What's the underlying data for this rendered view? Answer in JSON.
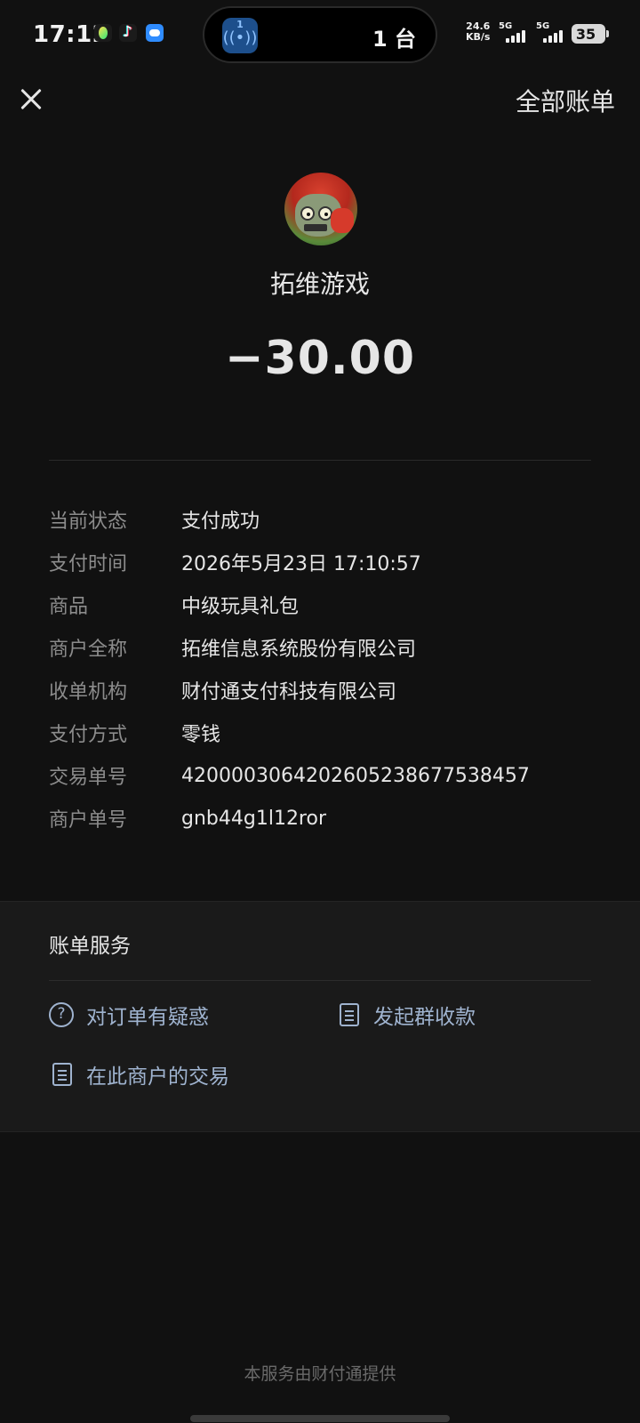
{
  "status_bar": {
    "time": "17:12",
    "island_count": "1",
    "island_text": "1 台",
    "net_speed_value": "24.6",
    "net_speed_unit": "KB/s",
    "sim1_label": "5G",
    "sim2_label": "5G",
    "battery": "35"
  },
  "header": {
    "all_bills_label": "全部账单"
  },
  "merchant": {
    "name": "拓维游戏",
    "amount": "−30.00"
  },
  "details": [
    {
      "key": "当前状态",
      "value": "支付成功"
    },
    {
      "key": "支付时间",
      "value": "2026年5月23日 17:10:57"
    },
    {
      "key": "商品",
      "value": "中级玩具礼包"
    },
    {
      "key": "商户全称",
      "value": "拓维信息系统股份有限公司"
    },
    {
      "key": "收单机构",
      "value": "财付通支付科技有限公司"
    },
    {
      "key": "支付方式",
      "value": "零钱"
    },
    {
      "key": "交易单号",
      "value": "4200003064202605238677538457"
    },
    {
      "key": "商户单号",
      "value": "gnb44g1l12ror"
    }
  ],
  "services": {
    "title": "账单服务",
    "items": [
      {
        "label": "对订单有疑惑",
        "icon": "question-circle-icon"
      },
      {
        "label": "发起群收款",
        "icon": "document-icon"
      },
      {
        "label": "在此商户的交易",
        "icon": "document-list-icon"
      }
    ]
  },
  "footer": "本服务由财付通提供",
  "colors": {
    "background": "#111111",
    "service_bg": "#1a1a1a",
    "link": "#9fb3cf",
    "label": "#8c8c8c"
  }
}
